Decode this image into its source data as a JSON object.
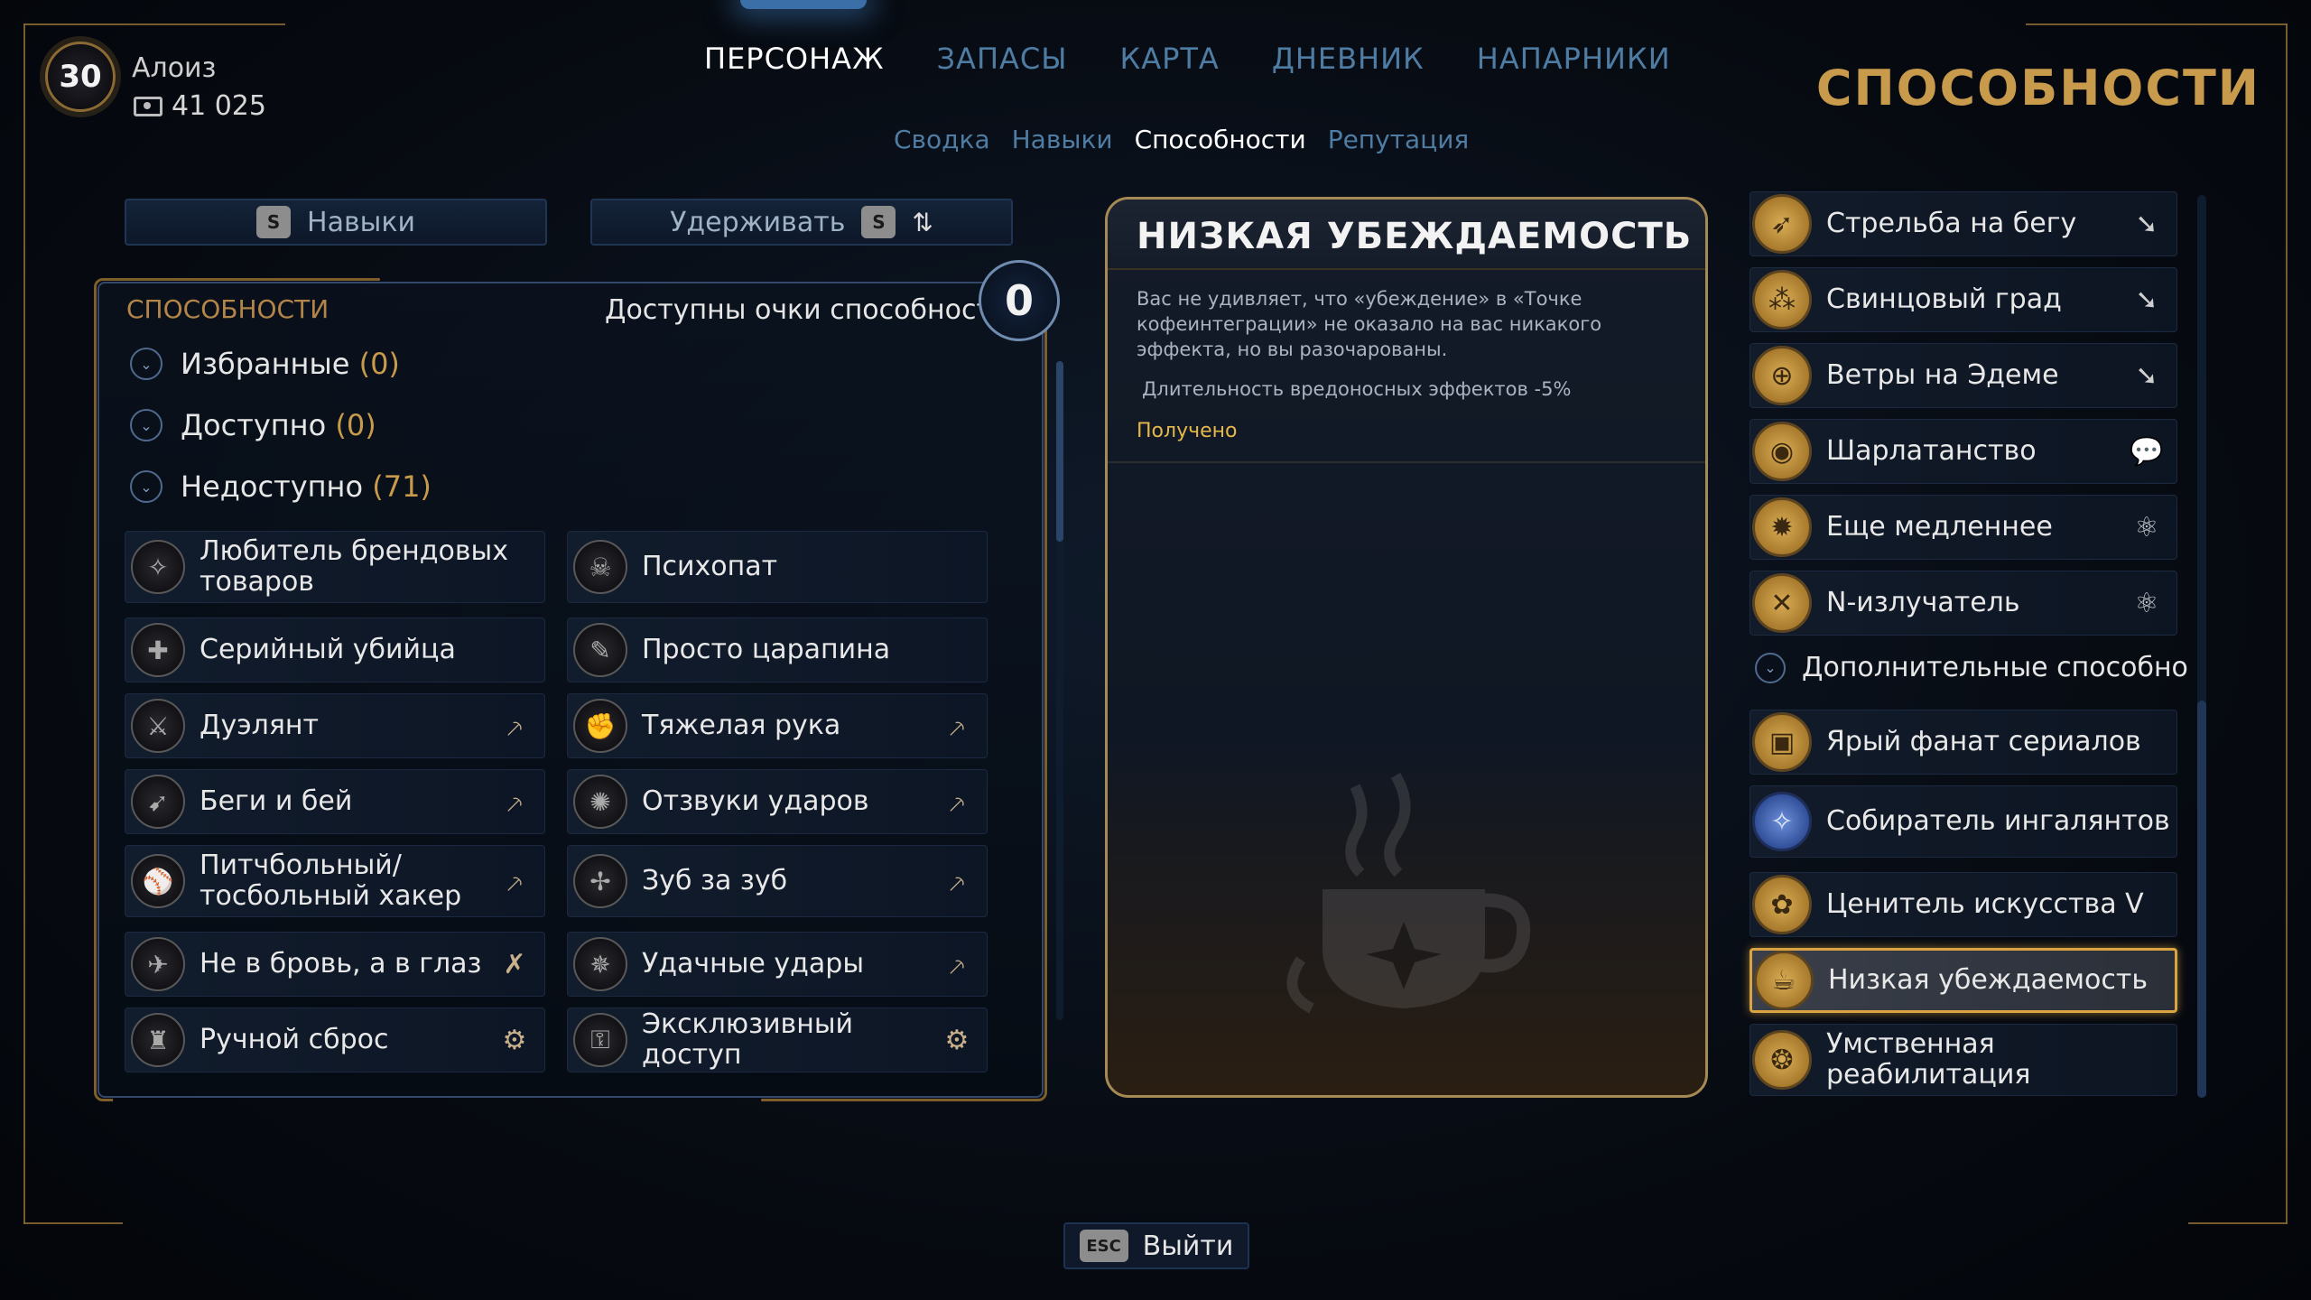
{
  "player": {
    "level": "30",
    "name": "Алоиз",
    "money": "41 025"
  },
  "top_nav": [
    {
      "label": "ПЕРСОНАЖ",
      "active": true
    },
    {
      "label": "ЗАПАСЫ",
      "active": false
    },
    {
      "label": "КАРТА",
      "active": false
    },
    {
      "label": "ДНЕВНИК",
      "active": false
    },
    {
      "label": "НАПАРНИКИ",
      "active": false
    }
  ],
  "sub_nav": [
    {
      "label": "Сводка",
      "active": false
    },
    {
      "label": "Навыки",
      "active": false
    },
    {
      "label": "Способности",
      "active": true
    },
    {
      "label": "Репутация",
      "active": false
    }
  ],
  "page_title": "СПОСОБНОСТИ",
  "controls": {
    "skills_key": "S",
    "skills_label": "Навыки",
    "hold_label": "Удерживать",
    "hold_key": "S",
    "sort_icon": "⇅"
  },
  "abilities_panel": {
    "header": "СПОСОБНОСТИ",
    "points_label": "Доступны очки способностей:",
    "points_value": "0",
    "categories": [
      {
        "label": "Избранные",
        "count": "(0)"
      },
      {
        "label": "Доступно",
        "count": "(0)"
      },
      {
        "label": "Недоступно",
        "count": "(71)"
      }
    ],
    "items": [
      {
        "label": "Любитель брендовых товаров",
        "icon": "brand-icon",
        "tag": ""
      },
      {
        "label": "Психопат",
        "icon": "psycho-icon",
        "tag": ""
      },
      {
        "label": "Серийный убийца",
        "icon": "killer-icon",
        "tag": ""
      },
      {
        "label": "Просто царапина",
        "icon": "scratch-icon",
        "tag": ""
      },
      {
        "label": "Дуэлянт",
        "icon": "duelist-icon",
        "tag": "melee"
      },
      {
        "label": "Тяжелая рука",
        "icon": "heavy-hand-icon",
        "tag": "melee"
      },
      {
        "label": "Беги и бей",
        "icon": "run-hit-icon",
        "tag": "melee"
      },
      {
        "label": "Отзвуки ударов",
        "icon": "echo-icon",
        "tag": "melee"
      },
      {
        "label": "Питчбольный/ тосбольный хакер",
        "icon": "hacker-icon",
        "tag": "melee"
      },
      {
        "label": "Зуб за зуб",
        "icon": "tooth-icon",
        "tag": "melee"
      },
      {
        "label": "Не в бровь, а в глаз",
        "icon": "eye-hit-icon",
        "tag": "critical"
      },
      {
        "label": "Удачные удары",
        "icon": "lucky-icon",
        "tag": "melee"
      },
      {
        "label": "Ручной сброс",
        "icon": "reset-icon",
        "tag": "tech"
      },
      {
        "label": "Эксклюзивный доступ",
        "icon": "access-icon",
        "tag": "tech"
      }
    ]
  },
  "detail": {
    "title": "НИЗКАЯ УБЕЖДАЕМОСТЬ",
    "description": "Вас не удивляет, что «убеждение» в «Точке кофеинтеграции» не оказало на вас никакого эффекта, но вы разочарованы.",
    "effect": "Длительность вредоносных эффектов -5%",
    "status": "Получено",
    "art_icon": "coffee-cup-icon"
  },
  "right_list": {
    "items_top": [
      {
        "label": "Стрельба на бегу",
        "tag": "gun"
      },
      {
        "label": "Свинцовый град",
        "tag": "gun"
      },
      {
        "label": "Ветры на Эдеме",
        "tag": "gun"
      },
      {
        "label": "Шарлатанство",
        "tag": "dialog"
      },
      {
        "label": "Еще медленнее",
        "tag": "science"
      },
      {
        "label": "N-излучатель",
        "tag": "science"
      }
    ],
    "category": "Дополнительные способности",
    "items_bottom": [
      {
        "label": "Ярый фанат сериалов",
        "selected": false,
        "blue": false
      },
      {
        "label": "Собиратель ингалянтов",
        "selected": false,
        "blue": true
      },
      {
        "label": "Ценитель искусства V",
        "selected": false,
        "blue": false
      },
      {
        "label": "Низкая убеждаемость",
        "selected": true,
        "blue": false
      },
      {
        "label": "Умственная реабилитация",
        "selected": false,
        "blue": false
      }
    ]
  },
  "exit": {
    "key": "ESC",
    "label": "Выйти"
  },
  "colors": {
    "gold": "#c89a4b",
    "nav_inactive": "#4f7ca3",
    "selected_border": "#d9a441",
    "status": "#e5b84a"
  }
}
